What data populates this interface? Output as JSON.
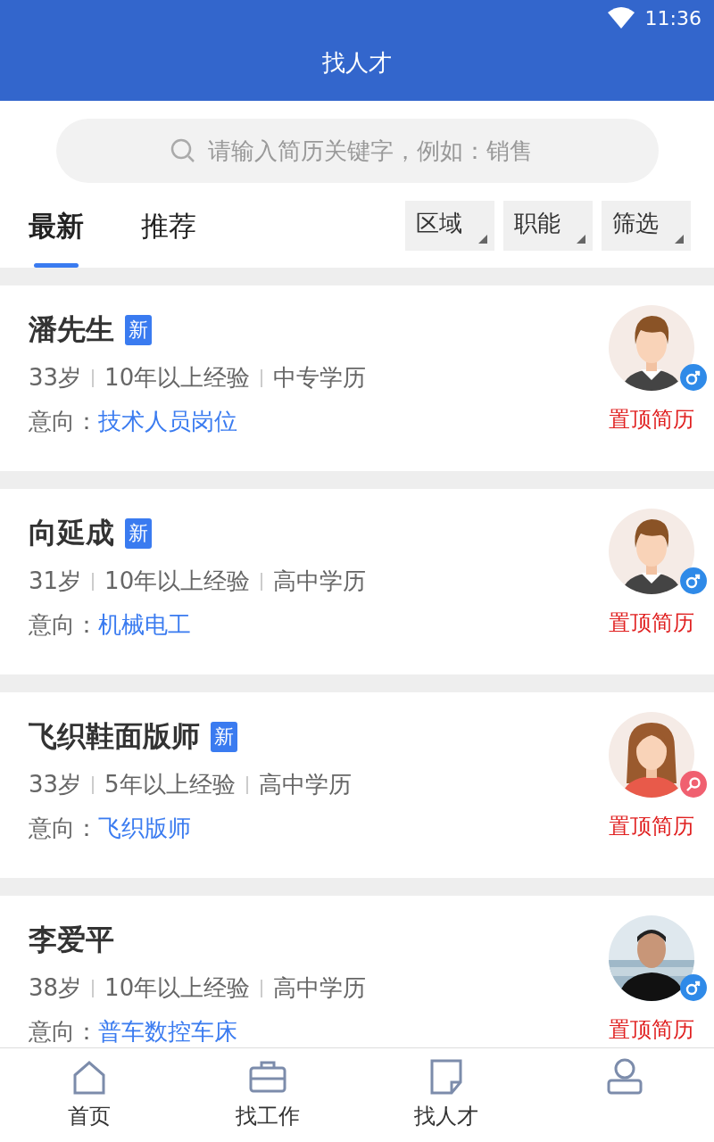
{
  "status_bar": {
    "time": "11:36"
  },
  "header": {
    "title": "找人才"
  },
  "search": {
    "placeholder": "请输入简历关键字，例如：销售"
  },
  "tabs": [
    {
      "label": "最新",
      "selected": true
    },
    {
      "label": "推荐",
      "selected": false
    }
  ],
  "filters": [
    "区域",
    "职能",
    "筛选"
  ],
  "resumes": [
    {
      "name": "潘先生",
      "badge": "新",
      "age": "33岁",
      "experience": "10年以上经验",
      "education": "中专学历",
      "intent_label": "意向：",
      "intent": "技术人员岗位",
      "kind": "man",
      "color": "#2f8ae8",
      "action": "置顶简历"
    },
    {
      "name": "向延成",
      "badge": "新",
      "age": "31岁",
      "experience": "10年以上经验",
      "education": "高中学历",
      "intent_label": "意向：",
      "intent": "机械电工",
      "kind": "man",
      "color": "#2f8ae8",
      "action": "置顶简历"
    },
    {
      "name": "飞织鞋面版师",
      "badge": "新",
      "age": "33岁",
      "experience": "5年以上经验",
      "education": "高中学历",
      "intent_label": "意向：",
      "intent": "飞织版师",
      "kind": "woman",
      "color": "#f06070",
      "action": "置顶简历"
    },
    {
      "name": "李爱平",
      "age": "38岁",
      "experience": "10年以上经验",
      "education": "高中学历",
      "intent_label": "意向：",
      "intent": "普车数控车床",
      "color": "#2f8ae8",
      "action": "置顶简历"
    }
  ],
  "bottom_nav": [
    {
      "label": "首页",
      "kind": "home"
    },
    {
      "label": "找工作",
      "kind": "briefcase"
    },
    {
      "label": "找人才",
      "kind": "note"
    },
    {
      "kind": "person"
    }
  ]
}
